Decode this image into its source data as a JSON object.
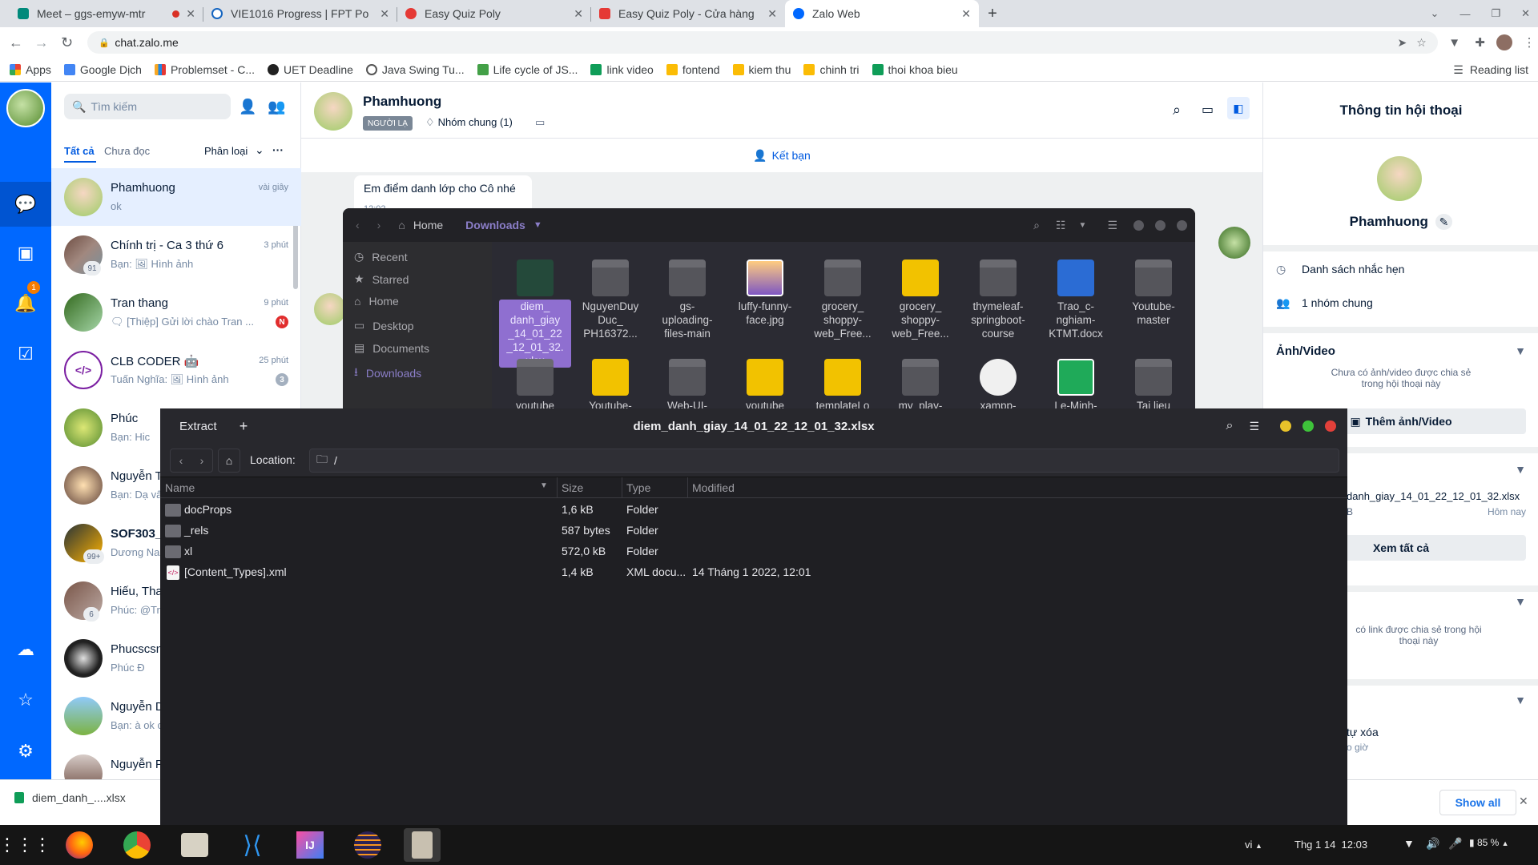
{
  "browser": {
    "tabs": [
      {
        "title": "Meet – ggs-emyw-mtr",
        "recording": true,
        "color": "#00897b"
      },
      {
        "title": "VIE1016 Progress | FPT Po",
        "color": "#1565c0"
      },
      {
        "title": "Easy Quiz Poly",
        "color": "#e53935"
      },
      {
        "title": "Easy Quiz Poly - Cửa hàng",
        "color": "#e53935"
      },
      {
        "title": "Zalo Web",
        "color": "#0068ff"
      }
    ],
    "url": "chat.zalo.me",
    "bookmarks": [
      "Apps",
      "Google Dịch",
      "Problemset - C...",
      "UET Deadline",
      "Java Swing Tu...",
      "Life cycle of JS...",
      "link video",
      "fontend",
      "kiem thu",
      "chinh tri",
      "thoi khoa bieu"
    ],
    "reading_list": "Reading list"
  },
  "zalo": {
    "search_placeholder": "Tìm kiếm",
    "filters": {
      "all": "Tất cả",
      "unread": "Chưa đọc",
      "classify": "Phân loại"
    },
    "rail_badge": "1",
    "conversations": [
      {
        "name": "Phamhuong",
        "preview": "ok",
        "time": "vài giây",
        "selected": true
      },
      {
        "name": "Chính trị - Ca 3 thứ 6",
        "preview": "Bạn: 🖼 Hình ảnh",
        "time": "3 phút",
        "count": "91"
      },
      {
        "name": "Tran thang",
        "preview": "🗨 [Thiệp] Gửi lời chào Tran ...",
        "time": "9 phút",
        "badge": "N"
      },
      {
        "name": "CLB CODER 🤖",
        "preview": "Tuấn Nghĩa: 🖼 Hình ảnh",
        "time": "25 phút",
        "badge": "3"
      },
      {
        "name": "Phúc",
        "preview": "Bạn: Hic"
      },
      {
        "name": "Nguyễn T",
        "preview": "Bạn: Dạ vâ"
      },
      {
        "name": "SOF303_",
        "preview": "Dương Na",
        "count": "99+"
      },
      {
        "name": "Hiếu, Tha",
        "preview": "Phúc: @Tri",
        "count": "6"
      },
      {
        "name": "Phucscsn",
        "preview": "Phúc Đ"
      },
      {
        "name": "Nguyễn D",
        "preview": "Bạn: à ok c"
      },
      {
        "name": "Nguyễn P",
        "preview": ""
      }
    ],
    "chat": {
      "name": "Phamhuong",
      "tag": "NGƯỜI LẠ",
      "group": "Nhóm chung (1)",
      "add_friend": "Kết bạn",
      "message": "Em điểm danh lớp cho Cô nhé",
      "message_time": "12:02"
    },
    "info": {
      "title": "Thông tin hội thoại",
      "name": "Phamhuong",
      "reminders": "Danh sách nhắc hẹn",
      "groups": "1 nhóm chung",
      "media_title": "Ảnh/Video",
      "media_empty": "Chưa có ảnh/video được chia sẻ trong hội thoại này",
      "add_media": "Thêm ảnh/Video",
      "file_name": "danh_giay_14_01_22_12_01_32.xlsx",
      "file_size": "B",
      "file_time": "Hôm nay",
      "see_all": "Xem tất cả",
      "links_empty": "có link được chia sẻ trong hội thoại này",
      "auto_delete": "tự xóa",
      "auto_delete_sub": "o giờ"
    }
  },
  "download_bar": {
    "file": "diem_danh_....xlsx",
    "show_all": "Show all"
  },
  "file_manager": {
    "path_home": "Home",
    "path_current": "Downloads",
    "sidebar": [
      "Recent",
      "Starred",
      "Home",
      "Desktop",
      "Documents",
      "Downloads"
    ],
    "files_row1": [
      {
        "name": "diem_\ndanh_giay\n_14_01_22\n_12_01_32.\nxlsx",
        "kind": "xlsx",
        "selected": true
      },
      {
        "name": "NguyenDuy\nDuc_\nPH16372...",
        "kind": "folder"
      },
      {
        "name": "gs-\nuploading-\nfiles-main",
        "kind": "folder"
      },
      {
        "name": "luffy-funny-\nface.jpg",
        "kind": "image"
      },
      {
        "name": "grocery_\nshoppy-\nweb_Free...",
        "kind": "folder"
      },
      {
        "name": "grocery_\nshoppy-\nweb_Free...",
        "kind": "zip"
      },
      {
        "name": "thymeleaf-\nspringboot-\ncourse",
        "kind": "folder"
      },
      {
        "name": "Trao_c-\nnghiam-\nKTMT.docx",
        "kind": "docx"
      },
      {
        "name": "Youtube-\nmaster",
        "kind": "folder"
      }
    ],
    "files_row2": [
      {
        "name": "youtube",
        "kind": "folder"
      },
      {
        "name": "Youtube-",
        "kind": "zip"
      },
      {
        "name": "Web-UI-",
        "kind": "folder"
      },
      {
        "name": "youtube",
        "kind": "zip"
      },
      {
        "name": "templateLo",
        "kind": "zip"
      },
      {
        "name": "my_play-",
        "kind": "folder"
      },
      {
        "name": "xampp-",
        "kind": "gear"
      },
      {
        "name": "Le-Minh-",
        "kind": "book"
      },
      {
        "name": "Tai lieu",
        "kind": "folder"
      }
    ]
  },
  "archive": {
    "extract": "Extract",
    "title": "diem_danh_giay_14_01_22_12_01_32.xlsx",
    "location_label": "Location:",
    "location_value": "/",
    "columns": {
      "name": "Name",
      "size": "Size",
      "type": "Type",
      "modified": "Modified"
    },
    "rows": [
      {
        "name": "docProps",
        "size": "1,6 kB",
        "type": "Folder",
        "modified": "",
        "kind": "folder"
      },
      {
        "name": "_rels",
        "size": "587 bytes",
        "type": "Folder",
        "modified": "",
        "kind": "folder"
      },
      {
        "name": "xl",
        "size": "572,0 kB",
        "type": "Folder",
        "modified": "",
        "kind": "folder"
      },
      {
        "name": "[Content_Types].xml",
        "size": "1,4 kB",
        "type": "XML docu...",
        "modified": "14 Tháng 1 2022, 12:01",
        "kind": "xml"
      }
    ]
  },
  "taskbar": {
    "lang": "vi",
    "clock": "Thg 1 14  12:03",
    "battery": "85 %"
  }
}
